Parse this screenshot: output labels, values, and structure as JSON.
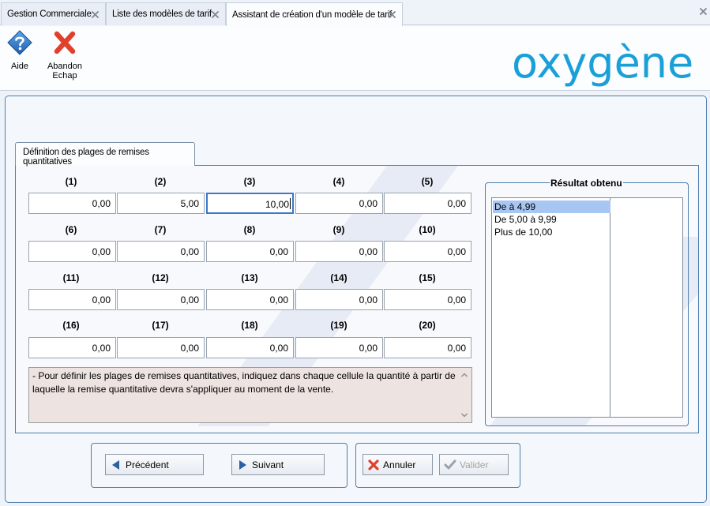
{
  "tabs": [
    {
      "label": "Gestion Commerciale",
      "active": false
    },
    {
      "label": "Liste des modèles de tarif",
      "active": false
    },
    {
      "label": "Assistant de création d'un modèle de tarif",
      "active": true
    }
  ],
  "toolbar": {
    "help_label": "Aide",
    "abandon_label": "Abandon\nEchap"
  },
  "logo": {
    "text": "oxygène",
    "color": "#1aa0d8"
  },
  "section_tab": {
    "label": "Définition des plages de remises quantitatives"
  },
  "fields": [
    {
      "label": "(1)",
      "value": "0,00"
    },
    {
      "label": "(2)",
      "value": "5,00"
    },
    {
      "label": "(3)",
      "value": "10,00",
      "focused": true
    },
    {
      "label": "(4)",
      "value": "0,00"
    },
    {
      "label": "(5)",
      "value": "0,00"
    },
    {
      "label": "(6)",
      "value": "0,00"
    },
    {
      "label": "(7)",
      "value": "0,00"
    },
    {
      "label": "(8)",
      "value": "0,00"
    },
    {
      "label": "(9)",
      "value": "0,00"
    },
    {
      "label": "(10)",
      "value": "0,00"
    },
    {
      "label": "(11)",
      "value": "0,00"
    },
    {
      "label": "(12)",
      "value": "0,00"
    },
    {
      "label": "(13)",
      "value": "0,00"
    },
    {
      "label": "(14)",
      "value": "0,00"
    },
    {
      "label": "(15)",
      "value": "0,00"
    },
    {
      "label": "(16)",
      "value": "0,00"
    },
    {
      "label": "(17)",
      "value": "0,00"
    },
    {
      "label": "(18)",
      "value": "0,00"
    },
    {
      "label": "(19)",
      "value": "0,00"
    },
    {
      "label": "(20)",
      "value": "0,00"
    }
  ],
  "hint": {
    "text": "- Pour définir les plages de remises quantitatives, indiquez dans chaque cellule la quantité à partir de laquelle la remise quantitative devra s'appliquer au moment de la vente."
  },
  "result": {
    "title": "Résultat obtenu",
    "items": [
      "De  à 4,99",
      "De 5,00 à 9,99",
      "Plus de 10,00"
    ],
    "selected_index": 0
  },
  "buttons": {
    "previous": "Précédent",
    "next": "Suivant",
    "cancel": "Annuler",
    "validate": "Valider"
  },
  "colors": {
    "accent": "#4f7fad",
    "help_icon": "#1f6fbf",
    "abandon_icon": "#e0412c",
    "arrow_icon": "#2d5fa5",
    "selection": "#a8c6f2"
  }
}
